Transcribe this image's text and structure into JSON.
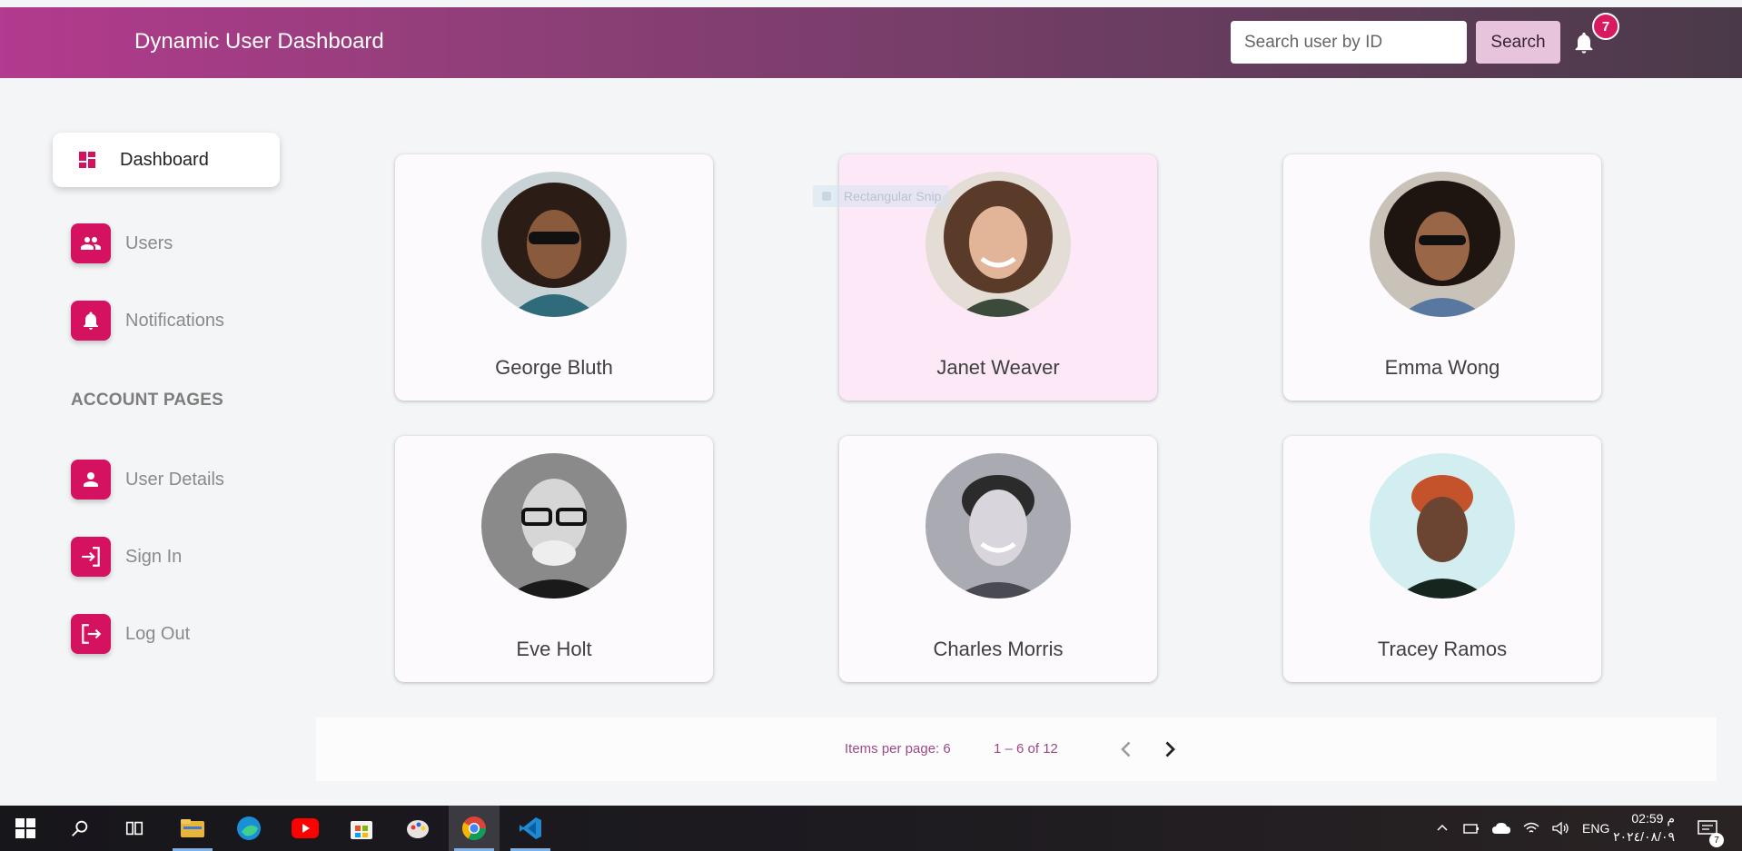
{
  "header": {
    "title": "Dynamic User Dashboard",
    "search_placeholder": "Search user by ID",
    "search_label": "Search",
    "notification_count": "7"
  },
  "sidebar": {
    "active_item": {
      "label": "Dashboard",
      "icon": "dashboard-icon"
    },
    "items": [
      {
        "label": "Users",
        "icon": "users-icon"
      },
      {
        "label": "Notifications",
        "icon": "bell-icon"
      }
    ],
    "section_title": "ACCOUNT PAGES",
    "account_items": [
      {
        "label": "User Details",
        "icon": "person-icon"
      },
      {
        "label": "Sign In",
        "icon": "sign-in-icon"
      },
      {
        "label": "Log Out",
        "icon": "log-out-icon"
      }
    ]
  },
  "cards": [
    {
      "name": "George Bluth"
    },
    {
      "name": "Janet Weaver"
    },
    {
      "name": "Emma Wong"
    },
    {
      "name": "Eve Holt"
    },
    {
      "name": "Charles Morris"
    },
    {
      "name": "Tracey Ramos"
    }
  ],
  "ghost_tooltip": "Rectangular Snip",
  "pagination": {
    "items_per_page": "Items per page: 6",
    "range": "1 – 6 of 12"
  },
  "taskbar": {
    "apps": [
      "windows-start-icon",
      "search-icon",
      "task-view-icon",
      "file-explorer-icon",
      "edge-icon",
      "youtube-icon",
      "store-icon",
      "paint-icon",
      "chrome-icon",
      "vscode-icon"
    ],
    "lang": "ENG",
    "time": "02:59 م",
    "date": "٢٠٢٤/٠٨/٠٩",
    "notification_count": "7"
  },
  "colors": {
    "accent": "#d4125f",
    "header_start": "#b33a8e",
    "header_end": "#4a3a48"
  }
}
